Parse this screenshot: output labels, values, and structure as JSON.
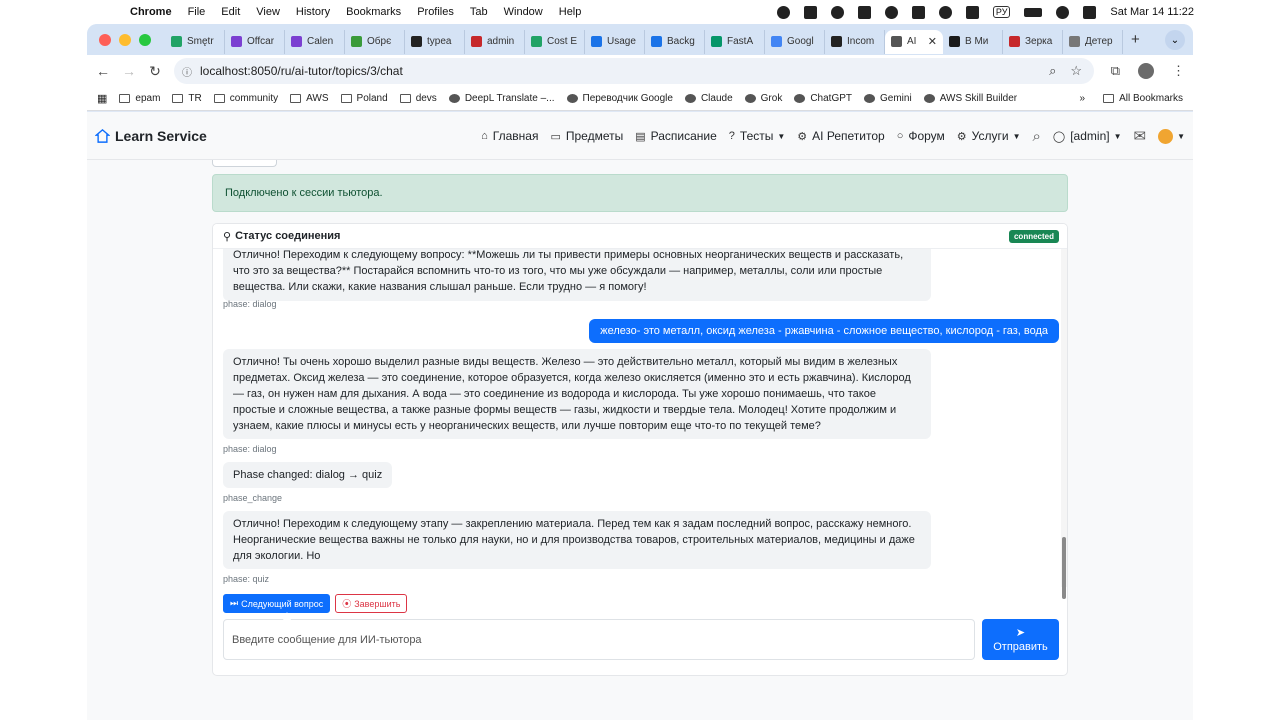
{
  "menubar": {
    "app": "Chrome",
    "items": [
      "File",
      "Edit",
      "View",
      "History",
      "Bookmarks",
      "Profiles",
      "Tab",
      "Window",
      "Help"
    ],
    "input_lang": "РУ",
    "clock": "Sat Mar 14  11:22"
  },
  "tabs": [
    {
      "label": "Smętr",
      "color": "#21a366"
    },
    {
      "label": "Offcar",
      "color": "#7b3fd1"
    },
    {
      "label": "Calen",
      "color": "#7b3fd1"
    },
    {
      "label": "Обрє",
      "color": "#3a9b3a"
    },
    {
      "label": "typea",
      "color": "#222222"
    },
    {
      "label": "admin",
      "color": "#c6282b"
    },
    {
      "label": "Cost E",
      "color": "#21a366"
    },
    {
      "label": "Usage",
      "color": "#1a73e8"
    },
    {
      "label": "Backg",
      "color": "#1a73e8"
    },
    {
      "label": "FastA",
      "color": "#059669"
    },
    {
      "label": "Googl",
      "color": "#4285f4"
    },
    {
      "label": "Incom",
      "color": "#222222"
    },
    {
      "label": "AI",
      "color": "#555555",
      "active": true
    },
    {
      "label": "В Ми",
      "color": "#1a1a1a"
    },
    {
      "label": "Зерка",
      "color": "#c6282b"
    },
    {
      "label": "Детер",
      "color": "#777777"
    }
  ],
  "toolbar": {
    "url": "localhost:8050/ru/ai-tutor/topics/3/chat"
  },
  "bookmarks": {
    "items": [
      "epam",
      "TR",
      "community",
      "AWS",
      "Poland",
      "devs",
      "DeepL Translate –...",
      "Переводчик Google",
      "Claude",
      "Grok",
      "ChatGPT",
      "Gemini",
      "AWS Skill Builder"
    ],
    "all_label": "All Bookmarks"
  },
  "nav": {
    "brand": "Learn Service",
    "links": [
      {
        "label": "Главная",
        "icon": "home-icon",
        "glyph": "⌂"
      },
      {
        "label": "Предметы",
        "icon": "book-icon",
        "glyph": "▭"
      },
      {
        "label": "Расписание",
        "icon": "calendar-icon",
        "glyph": "▤"
      },
      {
        "label": "Тесты",
        "icon": "question-icon",
        "glyph": "?",
        "caret": true
      },
      {
        "label": "AI Репетитор",
        "icon": "robot-icon",
        "glyph": "⚙"
      },
      {
        "label": "Форум",
        "icon": "chat-icon",
        "glyph": "○"
      },
      {
        "label": "Услуги",
        "icon": "gear-icon",
        "glyph": "⚙",
        "caret": true
      }
    ],
    "user": "[admin]"
  },
  "alert": {
    "text": "Подключено к сессии тьютора."
  },
  "chat": {
    "header": "Статус соединения",
    "status_badge": "connected",
    "messages": [
      {
        "role": "ai",
        "text": "Отлично! Переходим к следующему вопросу: **Можешь ли ты привести примеры основных неорганических веществ и рассказать, что это за вещества?** Постарайся вспомнить что-то из того, что мы уже обсуждали — например, металлы, соли или простые вещества. Или скажи, какие названия слышал раньше. Если трудно — я помогу!",
        "meta": "phase: dialog"
      },
      {
        "role": "user",
        "text": "железо- это металл, оксид железа - ржавчина - сложное вещество, кислород - газ, вода"
      },
      {
        "role": "ai",
        "text": "Отлично! Ты очень хорошо выделил разные виды веществ. Железо — это действительно металл, который мы видим в железных предметах. Оксид железа — это соединение, которое образуется, когда железо окисляется (именно это и есть ржавчина). Кислород — газ, он нужен нам для дыхания. А вода — это соединение из водорода и кислорода. Ты уже хорошо понимаешь, что такое простые и сложные вещества, а также разные формы веществ — газы, жидкости и твердые тела. Молодец! Хотите продолжим и узнаем, какие плюсы и минусы есть у неорганических веществ, или лучше повторим еще что-то по текущей теме?",
        "meta": "phase: dialog"
      },
      {
        "role": "ai",
        "text": "Phase changed: dialog → quiz",
        "meta": "phase_change"
      },
      {
        "role": "ai",
        "text": "Отлично! Переходим к следующему этапу — закреплению материала. Перед тем как я задам последний вопрос, расскажу немного. Неорганические вещества важны не только для науки, но и для производства товаров, строительных материалов, медицины и даже для экологии. Но",
        "meta": "phase: quiz"
      }
    ],
    "next_button": "Следующий вопрос",
    "finish_button": "Завершить",
    "input_placeholder": "Введите сообщение для ИИ-тьютора",
    "send_button": "Отправить"
  },
  "colors": {
    "primary": "#0d6efd",
    "success_bg": "#d1e7dd",
    "success_text": "#0f5132",
    "badge": "#198754",
    "danger": "#dc3545"
  }
}
